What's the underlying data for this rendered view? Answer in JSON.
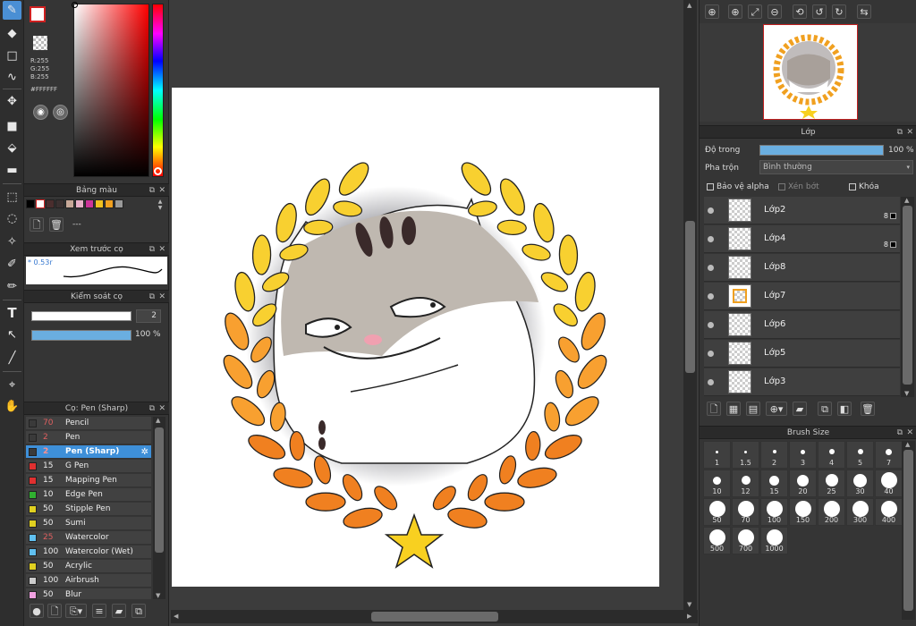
{
  "color": {
    "r": "R:255",
    "g": "G:255",
    "b": "B:255",
    "hex": "#FFFFFF"
  },
  "palette": {
    "title": "Bảng màu",
    "swatches": [
      "#000000",
      "#ffffff",
      "#4a2e2e",
      "#3a3030",
      "#c8a898",
      "#e8b0c8",
      "#cc3399",
      "#f0c020",
      "#f0a020",
      "#999999"
    ],
    "empty_label": "---"
  },
  "brush_preview": {
    "title": "Xem trước cọ",
    "size_label": "* 0.53r"
  },
  "brush_control": {
    "title": "Kiểm soát cọ",
    "size_value": "2",
    "opacity_value": "100 %",
    "opacity": 1.0
  },
  "brush_list": {
    "title": "Cọ: Pen (Sharp)",
    "items": [
      {
        "size": "70",
        "name": "Pencil",
        "color": "#3a3a3a",
        "size_color": "#e06060"
      },
      {
        "size": "2",
        "name": "Pen",
        "color": "#3a3a3a",
        "size_color": "#e06060"
      },
      {
        "size": "2",
        "name": "Pen (Sharp)",
        "color": "#3a3a3a",
        "size_color": "#ff8080",
        "selected": true
      },
      {
        "size": "15",
        "name": "G Pen",
        "color": "#e03030",
        "size_color": "#eeeeee"
      },
      {
        "size": "15",
        "name": "Mapping Pen",
        "color": "#e03030",
        "size_color": "#eeeeee"
      },
      {
        "size": "10",
        "name": "Edge Pen",
        "color": "#30b030",
        "size_color": "#eeeeee"
      },
      {
        "size": "50",
        "name": "Stipple Pen",
        "color": "#e0d020",
        "size_color": "#eeeeee"
      },
      {
        "size": "50",
        "name": "Sumi",
        "color": "#e0d020",
        "size_color": "#eeeeee"
      },
      {
        "size": "25",
        "name": "Watercolor",
        "color": "#60c0f0",
        "size_color": "#e06060"
      },
      {
        "size": "100",
        "name": "Watercolor (Wet)",
        "color": "#60c0f0",
        "size_color": "#eeeeee"
      },
      {
        "size": "50",
        "name": "Acrylic",
        "color": "#e0d020",
        "size_color": "#eeeeee"
      },
      {
        "size": "100",
        "name": "Airbrush",
        "color": "#cccccc",
        "size_color": "#eeeeee"
      },
      {
        "size": "50",
        "name": "Blur",
        "color": "#f0a0e0",
        "size_color": "#eeeeee"
      }
    ]
  },
  "layers": {
    "title": "Lớp",
    "opacity_label": "Độ trong",
    "opacity_value": "100 %",
    "opacity": 1.0,
    "blend_label": "Pha trộn",
    "blend_value": "Bình thường",
    "alpha_protect": "Bảo vệ alpha",
    "clipping": "Xén bớt",
    "lock": "Khóa",
    "items": [
      {
        "name": "Lớp2",
        "badge": "8"
      },
      {
        "name": "Lớp4",
        "badge": "8"
      },
      {
        "name": "Lớp8",
        "badge": ""
      },
      {
        "name": "Lớp7",
        "badge": ""
      },
      {
        "name": "Lớp6",
        "badge": ""
      },
      {
        "name": "Lớp5",
        "badge": ""
      },
      {
        "name": "Lớp3",
        "badge": ""
      }
    ]
  },
  "brush_size": {
    "title": "Brush Size",
    "sizes": [
      "1",
      "1.5",
      "2",
      "3",
      "4",
      "5",
      "7",
      "10",
      "12",
      "15",
      "20",
      "25",
      "30",
      "40",
      "50",
      "70",
      "100",
      "150",
      "200",
      "300",
      "400",
      "500",
      "700",
      "1000"
    ]
  }
}
